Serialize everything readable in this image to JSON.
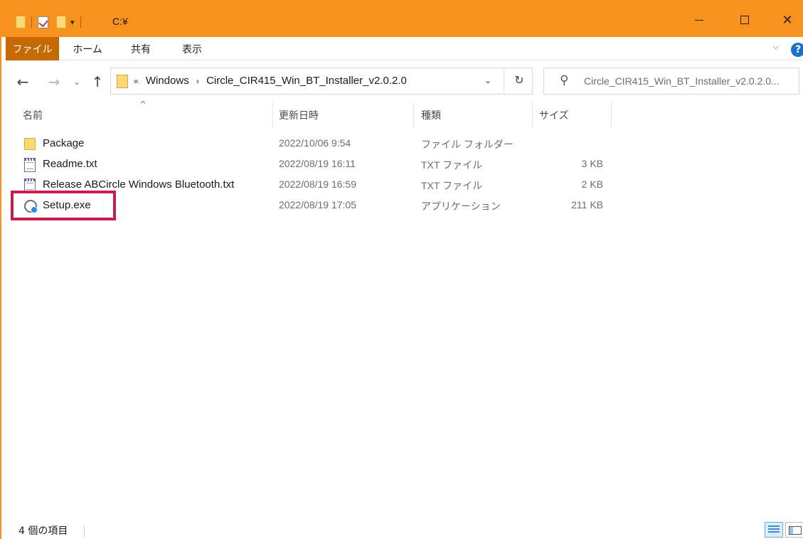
{
  "window": {
    "title": "C:¥",
    "accent_color": "#f7921e",
    "file_tab_color": "#c46a00",
    "minimize_icon": "minimize-icon",
    "maximize_icon": "maximize-icon",
    "close_glyph": "✕"
  },
  "ribbon": {
    "tabs": [
      {
        "label": "ファイル"
      },
      {
        "label": "ホーム"
      },
      {
        "label": "共有"
      },
      {
        "label": "表示"
      }
    ],
    "help_glyph": "?",
    "expand_glyph": "⌵"
  },
  "nav": {
    "back_glyph": "←",
    "forward_glyph": "→",
    "recent_glyph": "⌄",
    "up_glyph": "↑"
  },
  "address": {
    "overflow_glyph": "«",
    "crumbs": [
      "Windows",
      "Circle_CIR415_Win_BT_Installer_v2.0.2.0"
    ],
    "separator_glyph": "›",
    "dropdown_glyph": "⌄",
    "refresh_glyph": "↻"
  },
  "search": {
    "icon": "search-icon",
    "icon_glyph": "⚲",
    "placeholder": "Circle_CIR415_Win_BT_Installer_v2.0.2.0..."
  },
  "columns": {
    "name": "名前",
    "date": "更新日時",
    "type": "種類",
    "size": "サイズ",
    "sort_glyph": "^"
  },
  "files": [
    {
      "name": "Package",
      "date": "2022/10/06 9:54",
      "type": "ファイル フォルダー",
      "size": "",
      "icon": "folder-icon"
    },
    {
      "name": "Readme.txt",
      "date": "2022/08/19 16:11",
      "type": "TXT ファイル",
      "size": "3 KB",
      "icon": "text-file-icon"
    },
    {
      "name": "Release ABCircle Windows Bluetooth.txt",
      "date": "2022/08/19 16:59",
      "type": "TXT ファイル",
      "size": "2 KB",
      "icon": "text-file-icon"
    },
    {
      "name": "Setup.exe",
      "date": "2022/08/19 17:05",
      "type": "アプリケーション",
      "size": "211 KB",
      "icon": "setup-exe-icon"
    }
  ],
  "highlight_color": "#c81e4f",
  "status": {
    "item_count": "4 個の項目"
  }
}
